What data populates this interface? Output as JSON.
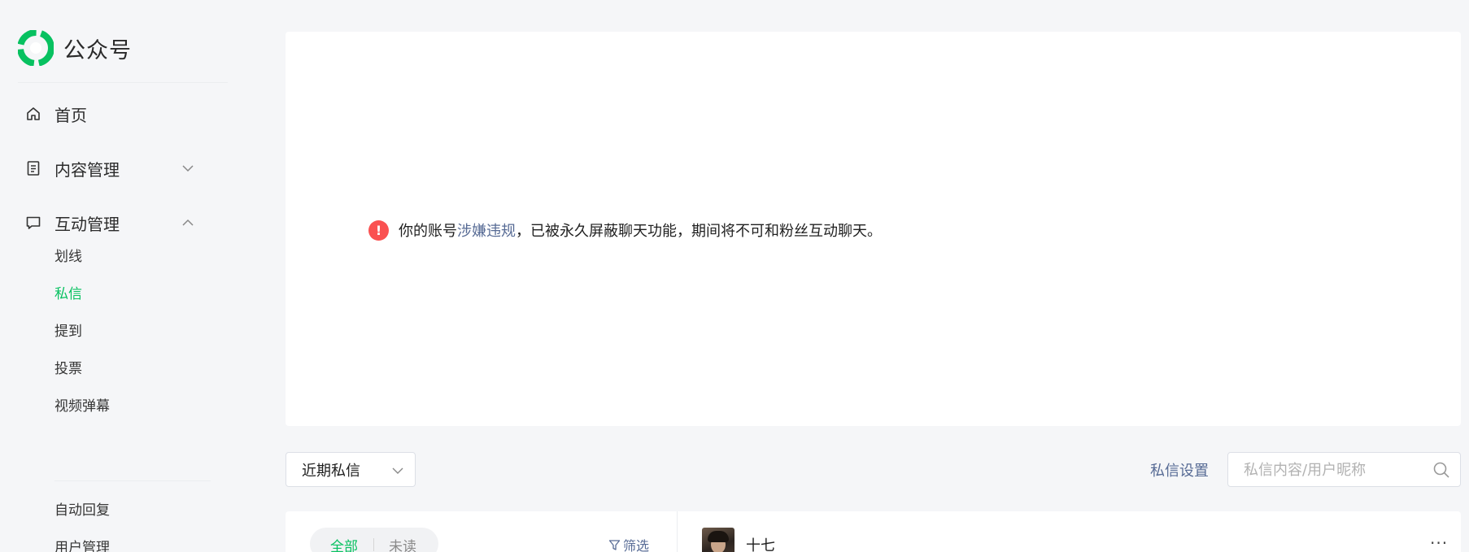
{
  "app": {
    "title": "公众号"
  },
  "sidebar": {
    "items": [
      {
        "label": "首页"
      },
      {
        "label": "内容管理"
      },
      {
        "label": "互动管理"
      }
    ],
    "sub_items": [
      {
        "label": "划线"
      },
      {
        "label": "私信"
      },
      {
        "label": "提到"
      },
      {
        "label": "投票"
      },
      {
        "label": "视频弹幕"
      },
      {
        "label": "自动回复"
      },
      {
        "label": "用户管理"
      }
    ],
    "active_sub_item": "私信"
  },
  "notice": {
    "prefix": "你的账号",
    "link": "涉嫌违规",
    "suffix": "，已被永久屏蔽聊天功能，期间将不可和粉丝互动聊天。"
  },
  "toolbar": {
    "select_value": "近期私信",
    "settings_label": "私信设置",
    "search_placeholder": "私信内容/用户昵称"
  },
  "messages": {
    "tabs": [
      {
        "label": "全部"
      },
      {
        "label": "未读"
      }
    ],
    "filter_label": "筛选",
    "chat_name": "十七",
    "more_label": "···"
  },
  "colors": {
    "accent": "#07c160",
    "link": "#576b95",
    "warning": "#fa5151",
    "background": "#f5f6f8"
  }
}
